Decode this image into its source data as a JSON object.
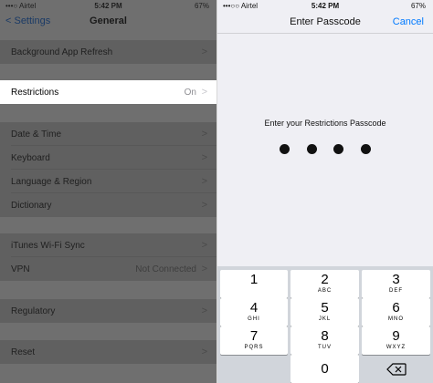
{
  "left": {
    "status": {
      "carrier": "•••○ Airtel",
      "time": "5:42 PM",
      "battery": "67%"
    },
    "nav": {
      "back": "< Settings",
      "title": "General"
    },
    "cells": [
      {
        "label": "Background App Refresh",
        "value": ""
      },
      {
        "label": "Restrictions",
        "value": "On"
      },
      {
        "label": "Date & Time",
        "value": ""
      },
      {
        "label": "Keyboard",
        "value": ""
      },
      {
        "label": "Language & Region",
        "value": ""
      },
      {
        "label": "Dictionary",
        "value": ""
      },
      {
        "label": "iTunes Wi-Fi Sync",
        "value": ""
      },
      {
        "label": "VPN",
        "value": "Not Connected"
      },
      {
        "label": "Regulatory",
        "value": ""
      },
      {
        "label": "Reset",
        "value": ""
      }
    ]
  },
  "right": {
    "status": {
      "carrier": "•••○○ Airtel",
      "time": "5:42 PM",
      "battery": "67%"
    },
    "nav": {
      "title": "Enter Passcode",
      "cancel": "Cancel"
    },
    "prompt": "Enter your Restrictions Passcode",
    "entered_digits": 4,
    "keys": [
      {
        "num": "1",
        "letters": ""
      },
      {
        "num": "2",
        "letters": "ABC"
      },
      {
        "num": "3",
        "letters": "DEF"
      },
      {
        "num": "4",
        "letters": "GHI"
      },
      {
        "num": "5",
        "letters": "JKL"
      },
      {
        "num": "6",
        "letters": "MNO"
      },
      {
        "num": "7",
        "letters": "PQRS"
      },
      {
        "num": "8",
        "letters": "TUV"
      },
      {
        "num": "9",
        "letters": "WXYZ"
      },
      {
        "num": "0",
        "letters": ""
      }
    ]
  }
}
